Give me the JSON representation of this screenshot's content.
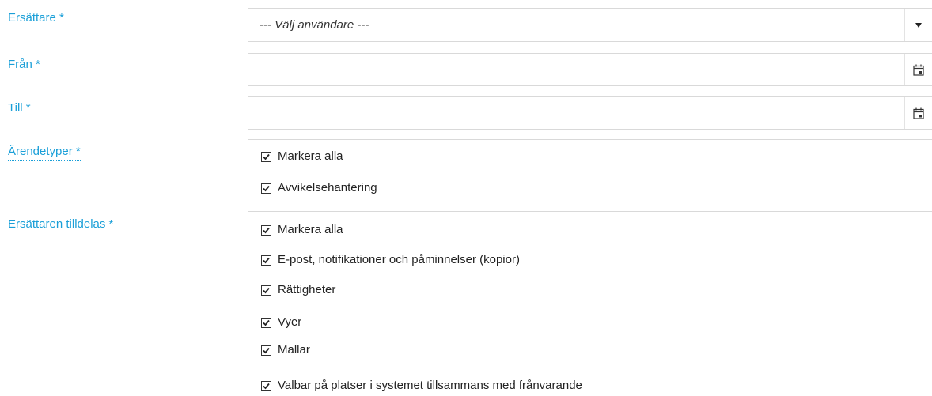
{
  "substitute": {
    "label": "Ersättare *",
    "placeholder": "--- Välj användare ---",
    "arrow_icon": "dropdown-arrow-icon"
  },
  "from": {
    "label": "Från *",
    "value": "",
    "icon": "calendar-icon"
  },
  "to": {
    "label": "Till *",
    "value": "",
    "icon": "calendar-icon"
  },
  "case_types": {
    "label": "Ärendetyper *",
    "options": [
      {
        "label": "Markera alla",
        "checked": true
      },
      {
        "label": "Avvikelsehantering",
        "checked": true
      }
    ]
  },
  "assigned": {
    "label": "Ersättaren tilldelas *",
    "options": [
      {
        "label": "Markera alla",
        "checked": true
      },
      {
        "label": "E-post, notifikationer och påminnelser (kopior)",
        "checked": true
      },
      {
        "label": "Rättigheter",
        "checked": true
      },
      {
        "label": "Vyer",
        "checked": true
      },
      {
        "label": "Mallar",
        "checked": true
      },
      {
        "label": "Valbar på platser i systemet tillsammans med frånvarande",
        "checked": true
      }
    ]
  },
  "colors": {
    "label": "#1a9fd8",
    "border": "#d9d9d9",
    "text": "#222222"
  }
}
